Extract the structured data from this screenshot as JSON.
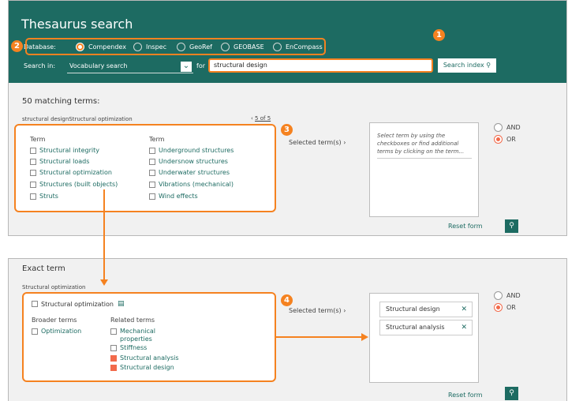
{
  "header": {
    "title": "Thesaurus search",
    "database_label": "Database:",
    "databases": [
      {
        "label": "Compendex",
        "selected": true
      },
      {
        "label": "Inspec",
        "selected": false
      },
      {
        "label": "GeoRef",
        "selected": false
      },
      {
        "label": "GEOBASE",
        "selected": false
      },
      {
        "label": "EnCompass",
        "selected": false
      }
    ],
    "search_in_label": "Search in:",
    "search_in_value": "Vocabulary search",
    "for_label": "for",
    "search_value": "structural design",
    "search_button": "Search index"
  },
  "results": {
    "heading": "50 matching terms:",
    "breadcrumb": "structural designStructural optimization",
    "pager": "5 of 5",
    "col1_header": "Term",
    "col2_header": "Term",
    "col1": [
      "Structural integrity",
      "Structural loads",
      "Structural optimization",
      "Structures (built objects)",
      "Struts"
    ],
    "col2": [
      "Underground structures",
      "Undersnow structures",
      "Underwater structures",
      "Vibrations (mechanical)",
      "Wind effects"
    ],
    "selected_label": "Selected term(s)",
    "hint": "Select term by using the checkboxes or find additional terms by clicking on the term...",
    "and_label": "AND",
    "or_label": "OR",
    "reset": "Reset form"
  },
  "exact": {
    "heading": "Exact term",
    "term_label": "Structural optimization",
    "term_checkbox": "Structural optimization",
    "broader_header": "Broader terms",
    "related_header": "Related terms",
    "broader": [
      "Optimization"
    ],
    "related": [
      {
        "label": "Mechanical properties",
        "checked": false
      },
      {
        "label": "Stiffness",
        "checked": false
      },
      {
        "label": "Structural analysis",
        "checked": true
      },
      {
        "label": "Structural design",
        "checked": true
      }
    ],
    "selected_label": "Selected term(s)",
    "chips": [
      "Structural design",
      "Structural analysis"
    ],
    "and_label": "AND",
    "or_label": "OR",
    "reset": "Reset form"
  },
  "callouts": [
    "1",
    "2",
    "3",
    "4"
  ],
  "colors": {
    "header": "#1d6b62",
    "accent": "#f58220",
    "checked": "#f26a4b"
  }
}
